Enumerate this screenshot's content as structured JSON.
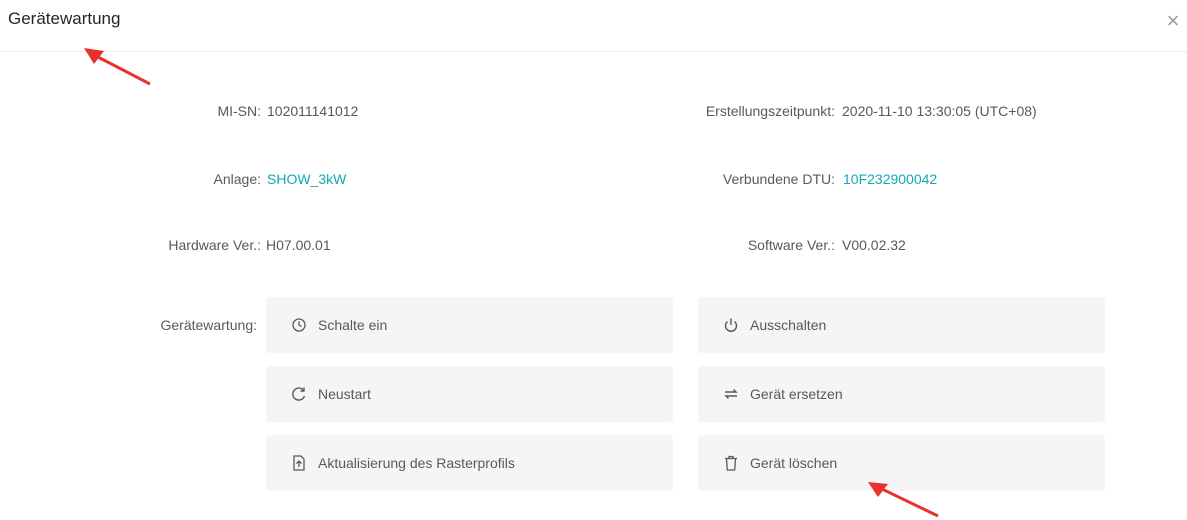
{
  "dialog": {
    "title": "Gerätewartung",
    "close_symbol": "×"
  },
  "info": {
    "mi_sn_label": "MI-SN:",
    "mi_sn_value": "102011141012",
    "created_label": "Erstellungszeitpunkt:",
    "created_value": "2020-11-10 13:30:05 (UTC+08)",
    "plant_label": "Anlage:",
    "plant_value": "SHOW_3kW",
    "dtu_label": "Verbundene DTU:",
    "dtu_value": "10F232900042",
    "hw_label": "Hardware Ver.:",
    "hw_value": "H07.00.01",
    "sw_label": "Software Ver.:",
    "sw_value": "V00.02.32"
  },
  "maintenance": {
    "label": "Gerätewartung:",
    "actions": [
      {
        "label": "Schalte ein",
        "icon": "clock-icon"
      },
      {
        "label": "Ausschalten",
        "icon": "power-icon"
      },
      {
        "label": "Neustart",
        "icon": "restart-icon"
      },
      {
        "label": "Gerät ersetzen",
        "icon": "swap-icon"
      },
      {
        "label": "Aktualisierung des Rasterprofils",
        "icon": "file-icon"
      },
      {
        "label": "Gerät löschen",
        "icon": "trash-icon"
      }
    ]
  },
  "colors": {
    "link": "#13a8b4",
    "annotation_arrow": "#e8322b",
    "button_bg": "#f5f5f5"
  }
}
